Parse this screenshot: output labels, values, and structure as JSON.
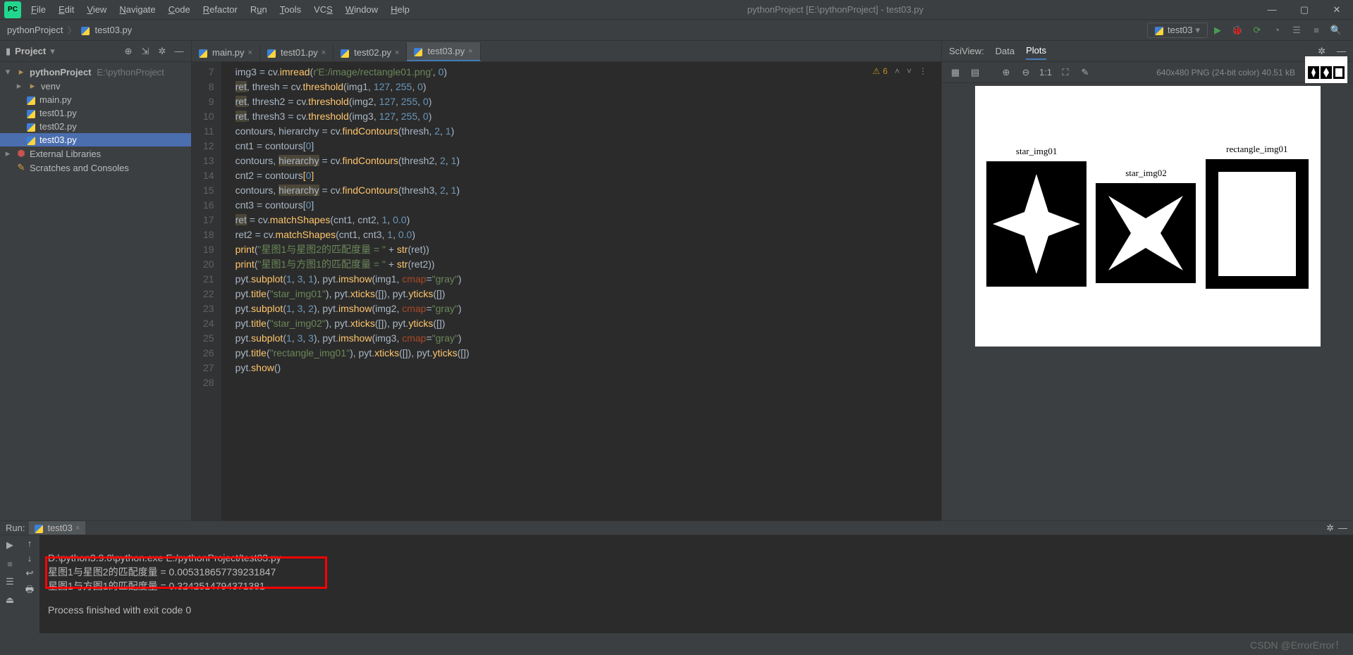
{
  "window": {
    "title": "pythonProject [E:\\pythonProject] - test03.py"
  },
  "menu": [
    "File",
    "Edit",
    "View",
    "Navigate",
    "Code",
    "Refactor",
    "Run",
    "Tools",
    "VCS",
    "Window",
    "Help"
  ],
  "breadcrumb": {
    "root": "pythonProject",
    "file": "test03.py"
  },
  "run_config": "test03",
  "project_panel": {
    "title": "Project",
    "root": "pythonProject",
    "root_path": "E:\\pythonProject",
    "venv": "venv",
    "files": [
      "main.py",
      "test01.py",
      "test02.py",
      "test03.py"
    ],
    "ext_lib": "External Libraries",
    "scratches": "Scratches and Consoles"
  },
  "editor_tabs": [
    {
      "name": "main.py",
      "active": false
    },
    {
      "name": "test01.py",
      "active": false
    },
    {
      "name": "test02.py",
      "active": false
    },
    {
      "name": "test03.py",
      "active": true
    }
  ],
  "warnings": {
    "count": "6"
  },
  "gutter": [
    "7",
    "8",
    "9",
    "10",
    "11",
    "12",
    "13",
    "14",
    "15",
    "16",
    "17",
    "18",
    "19",
    "20",
    "21",
    "22",
    "23",
    "24",
    "25",
    "26",
    "27",
    "28"
  ],
  "chart_data": {
    "type": "image-grid",
    "subplots": [
      {
        "title": "star_img01",
        "shape": "star4"
      },
      {
        "title": "star_img02",
        "shape": "star4concave"
      },
      {
        "title": "rectangle_img01",
        "shape": "rectangle"
      }
    ]
  },
  "sciview": {
    "label": "SciView:",
    "tabs": [
      "Data",
      "Plots"
    ],
    "active_tab": "Plots",
    "info": "640x480 PNG (24-bit color) 40.51 kB"
  },
  "run": {
    "label": "Run:",
    "tab": "test03",
    "cmd": "D:\\python3.9.0\\python.exe E:/pythonProject/test03.py",
    "out1": "星图1与星图2的匹配度量 = 0.005318657739231847",
    "out2": "星图1与方图1的匹配度量 = 0.3242514794371381",
    "exit": "Process finished with exit code 0"
  },
  "watermark": "CSDN @ErrorError！"
}
